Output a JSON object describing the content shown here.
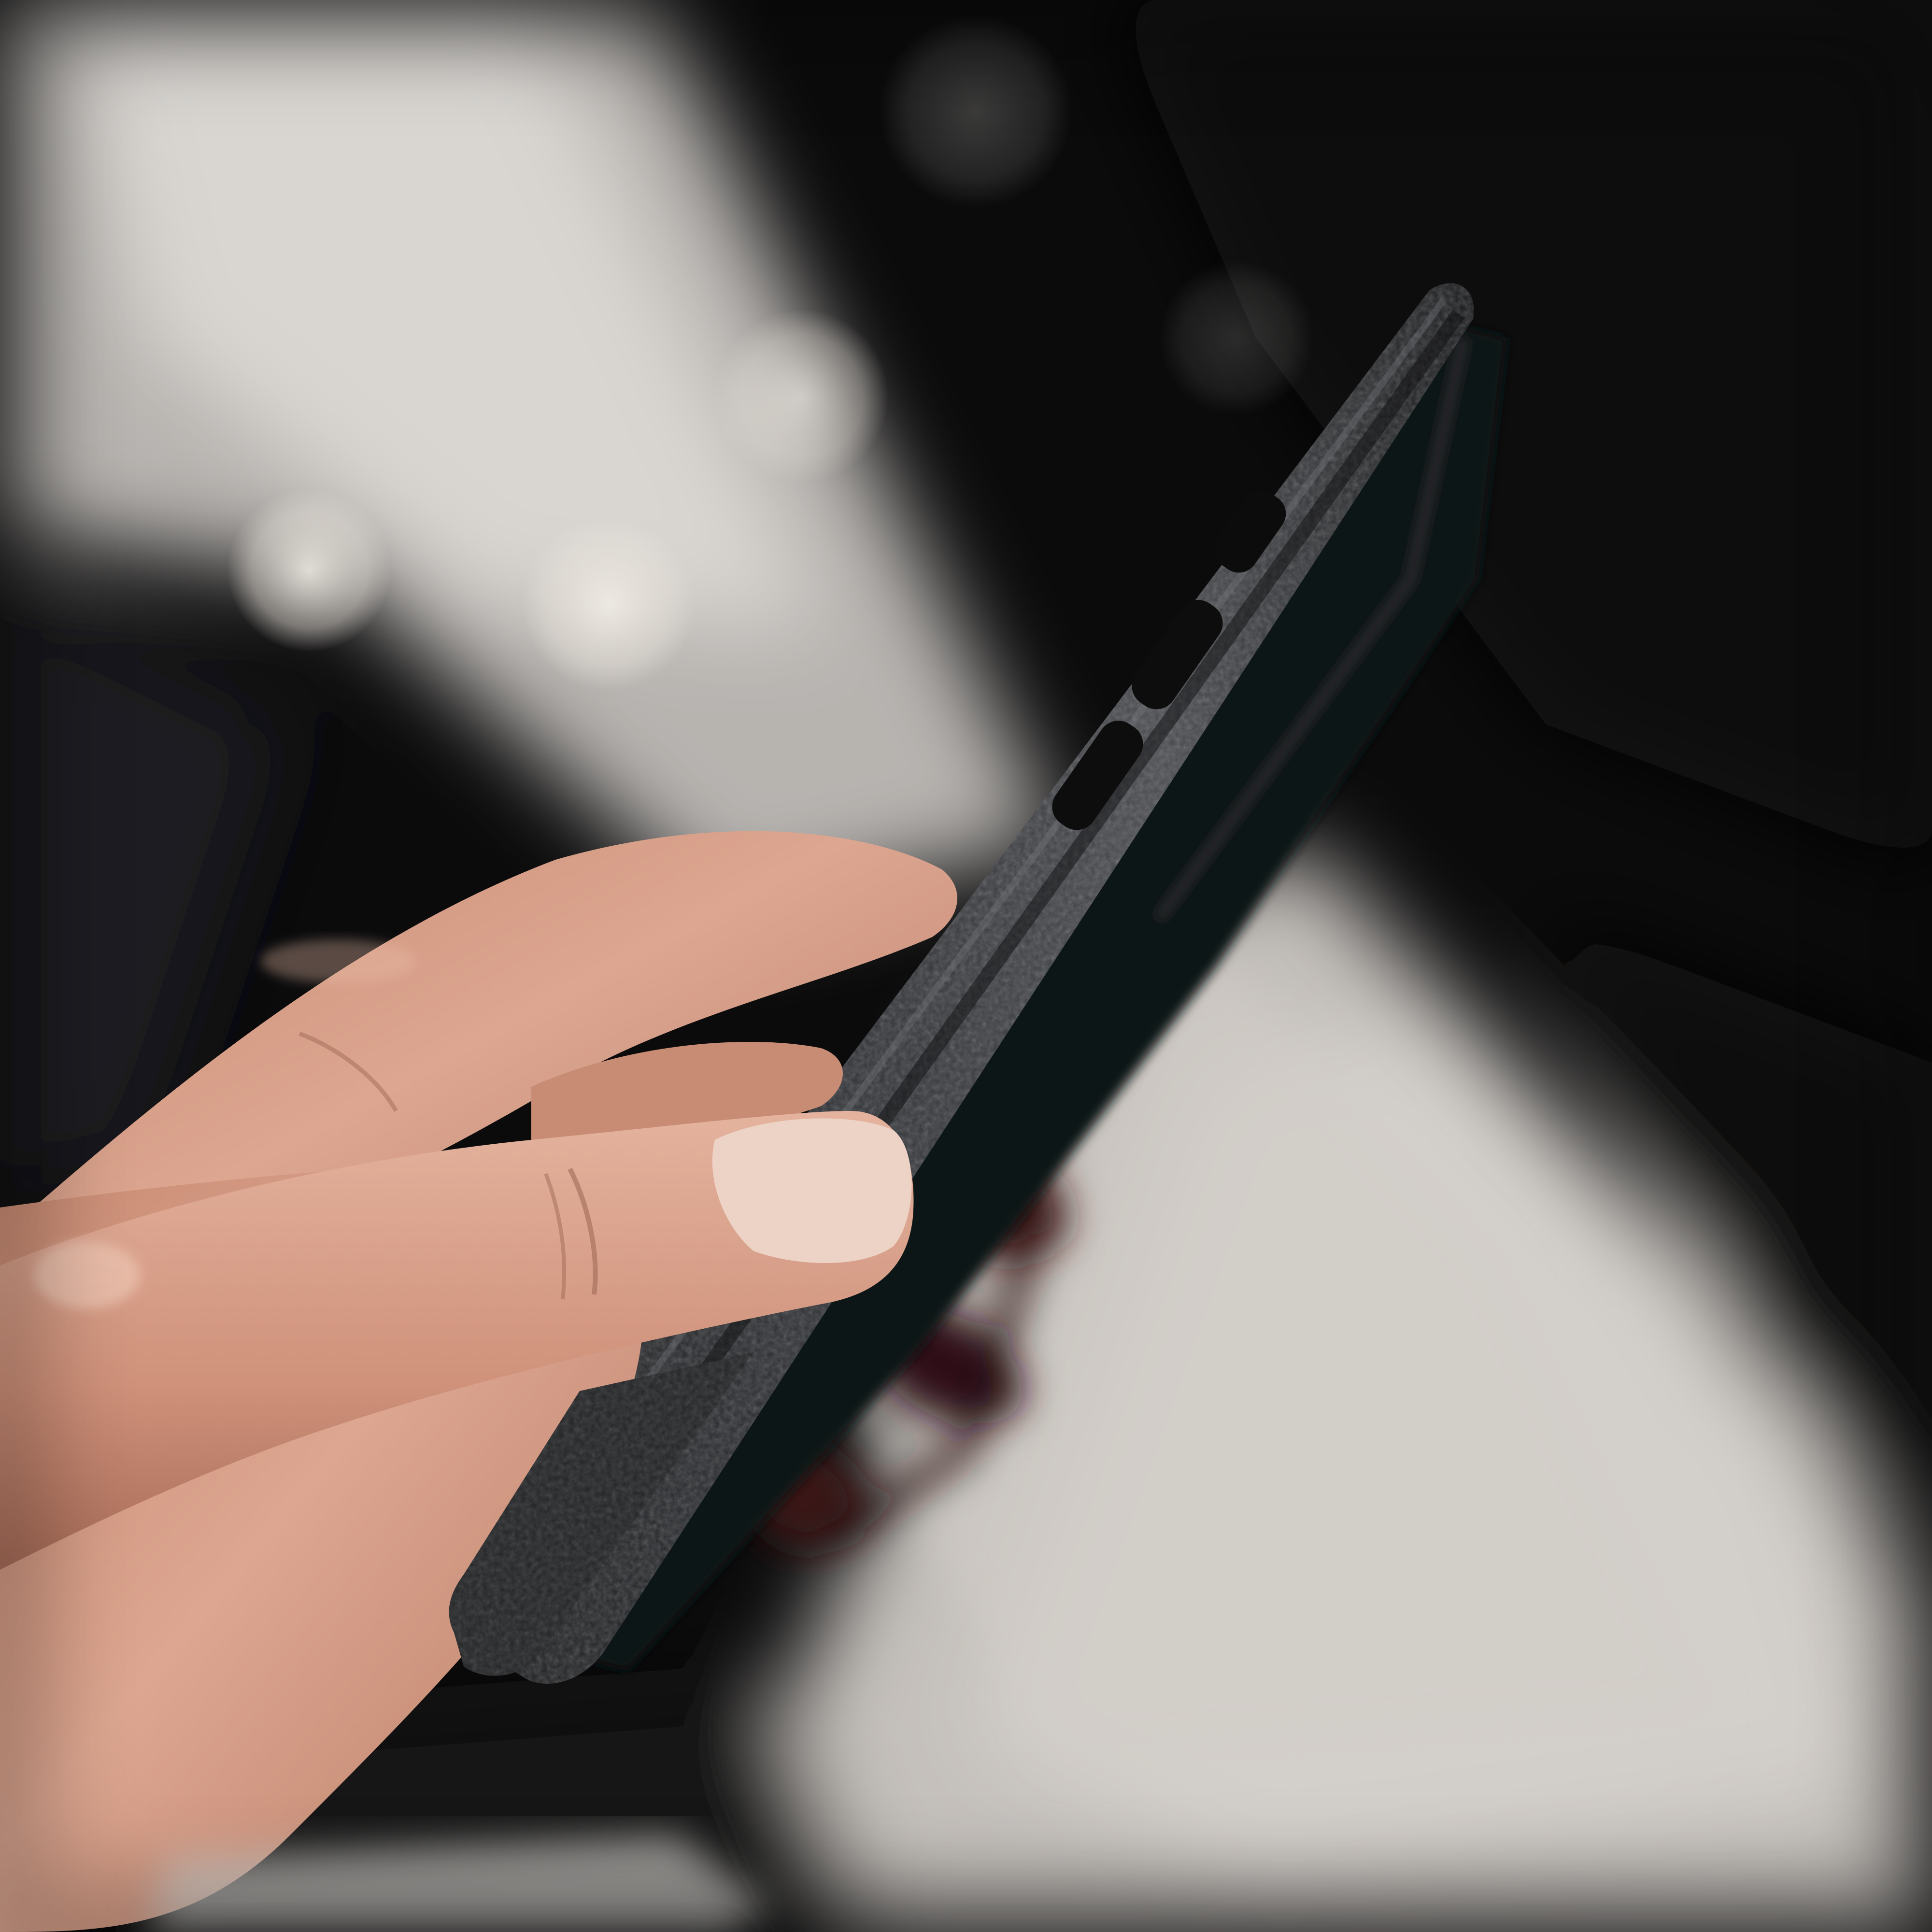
{
  "photo": {
    "subject": "hand-holding-phone-in-leather-case",
    "palette": {
      "background_dark": "#0b0b0c",
      "background_light": "#c9c6c2",
      "leather": "#2c2d2f",
      "leather_highlight": "#5b5d61",
      "skin": "#d8a48c",
      "skin_shadow": "#a8705c",
      "nail": "#e9cdbf",
      "accessory": "#3a1416"
    }
  }
}
